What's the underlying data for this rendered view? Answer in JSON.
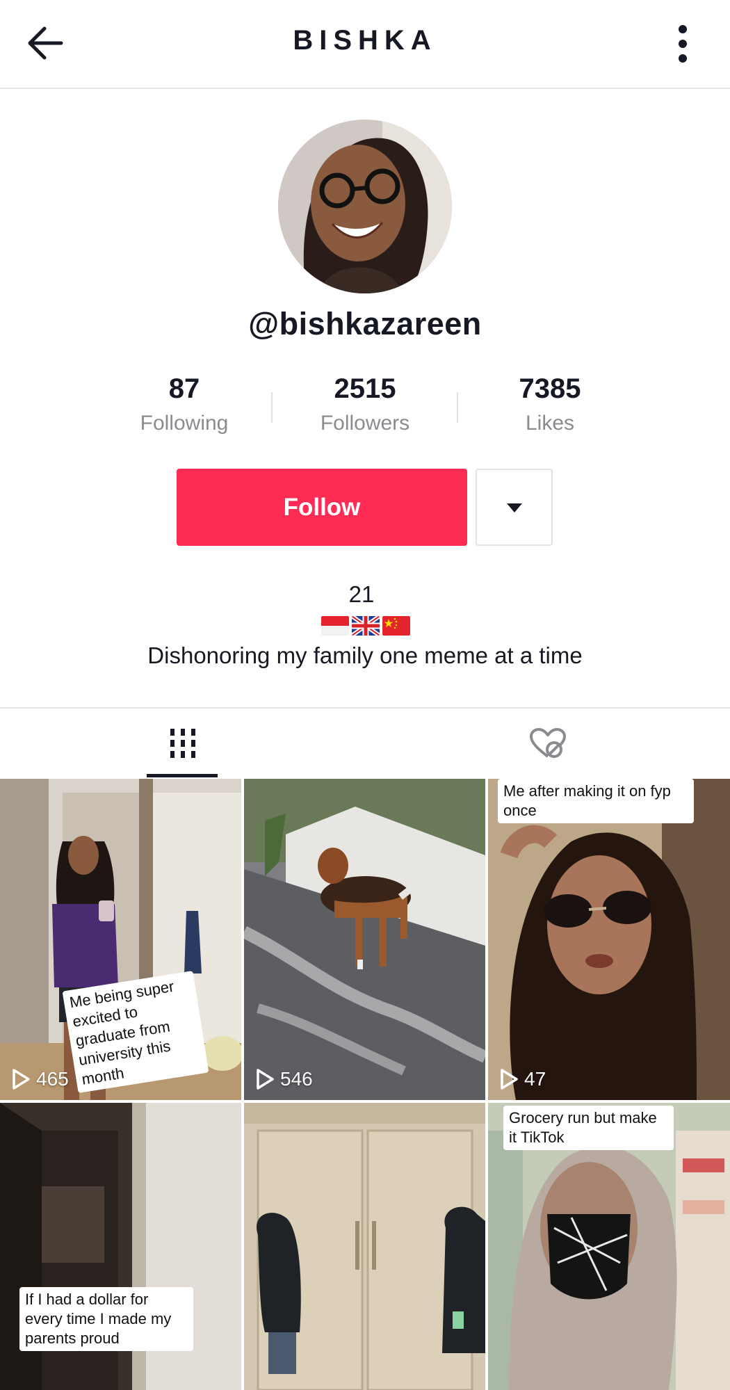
{
  "header": {
    "title": "BISHKA",
    "back_icon": "arrow-left-icon",
    "more_icon": "more-vertical-icon"
  },
  "profile": {
    "username": "@bishkazareen",
    "stats": [
      {
        "value": "87",
        "label": "Following"
      },
      {
        "value": "2515",
        "label": "Followers"
      },
      {
        "value": "7385",
        "label": "Likes"
      }
    ],
    "follow_label": "Follow",
    "accent_color": "#fe2c55",
    "bio": {
      "age": "21",
      "flags": [
        "flag-indonesia",
        "flag-uk",
        "flag-china"
      ],
      "description": "Dishonoring my family one meme at a time"
    }
  },
  "tabs": [
    {
      "name": "videos",
      "icon": "grid-icon",
      "selected": true
    },
    {
      "name": "liked",
      "icon": "liked-hidden-icon",
      "selected": false
    }
  ],
  "videos": [
    {
      "views": "465",
      "caption": "Me being super excited to graduate from university this month"
    },
    {
      "views": "546",
      "caption": ""
    },
    {
      "views": "47",
      "caption": "Me after making it on fyp once"
    },
    {
      "views": "",
      "caption": "If I had a dollar for every time I made my parents proud"
    },
    {
      "views": "",
      "caption": ""
    },
    {
      "views": "",
      "caption": "Grocery run but make it TikTok"
    }
  ]
}
